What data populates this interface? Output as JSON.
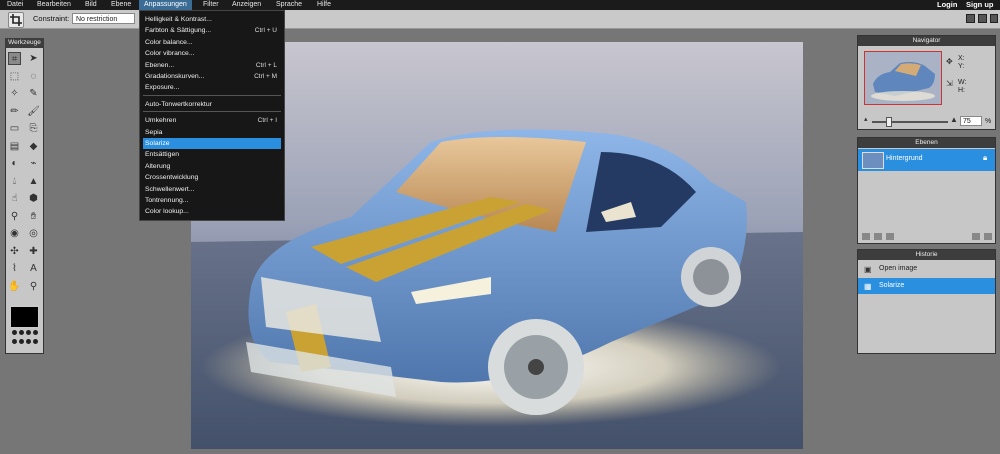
{
  "menubar": {
    "items": [
      "Datei",
      "Bearbeiten",
      "Bild",
      "Ebene",
      "Anpassungen",
      "Filter",
      "Anzeigen",
      "Sprache",
      "Hilfe"
    ],
    "login": "Login",
    "signup": "Sign up"
  },
  "options": {
    "constraint_label": "Constraint:",
    "constraint_value": "No restriction"
  },
  "tools": {
    "title": "Werkzeuge",
    "icons": [
      "crop-icon",
      "move-icon",
      "marquee-icon",
      "lasso-icon",
      "wand-icon",
      "pen-icon",
      "pencil-icon",
      "brush-icon",
      "eraser-icon",
      "clone-icon",
      "gradient-icon",
      "fill-icon",
      "replace-color-icon",
      "eyedropper-icon",
      "blur-icon",
      "sharpen-icon",
      "smudge-icon",
      "sponge-icon",
      "dodge-icon",
      "burn-icon",
      "redeye-icon",
      "bloat-icon",
      "pinch-icon",
      "spot-heal-icon",
      "picker-icon",
      "type-icon",
      "hand-icon",
      "zoom-icon"
    ],
    "foreground_color": "#000000"
  },
  "dropdown": {
    "items": [
      {
        "label": "Helligkeit & Kontrast...",
        "shortcut": ""
      },
      {
        "label": "Farbton & Sättigung...",
        "shortcut": "Ctrl + U"
      },
      {
        "label": "Color balance...",
        "shortcut": ""
      },
      {
        "label": "Color vibrance...",
        "shortcut": ""
      },
      {
        "label": "Ebenen...",
        "shortcut": "Ctrl + L"
      },
      {
        "label": "Gradationskurven...",
        "shortcut": "Ctrl + M"
      },
      {
        "label": "Exposure...",
        "shortcut": ""
      },
      {
        "label": "Auto-Tonwertkorrektur",
        "shortcut": ""
      },
      {
        "label": "Umkehren",
        "shortcut": "Ctrl + I"
      },
      {
        "label": "Sepia",
        "shortcut": ""
      },
      {
        "label": "Solarize",
        "shortcut": ""
      },
      {
        "label": "Entsättigen",
        "shortcut": ""
      },
      {
        "label": "Alterung",
        "shortcut": ""
      },
      {
        "label": "Crossentwicklung",
        "shortcut": ""
      },
      {
        "label": "Schwellenwert...",
        "shortcut": ""
      },
      {
        "label": "Tontrennung...",
        "shortcut": ""
      },
      {
        "label": "Color lookup...",
        "shortcut": ""
      }
    ]
  },
  "navigator": {
    "title": "Navigator",
    "x_label": "X:",
    "y_label": "Y:",
    "w_label": "W:",
    "h_label": "H:",
    "zoom": "75",
    "zoom_unit": "%"
  },
  "layers": {
    "title": "Ebenen",
    "layer_name": "Hintergrund"
  },
  "history": {
    "title": "Historie",
    "items": [
      "Open image",
      "Solarize"
    ]
  }
}
